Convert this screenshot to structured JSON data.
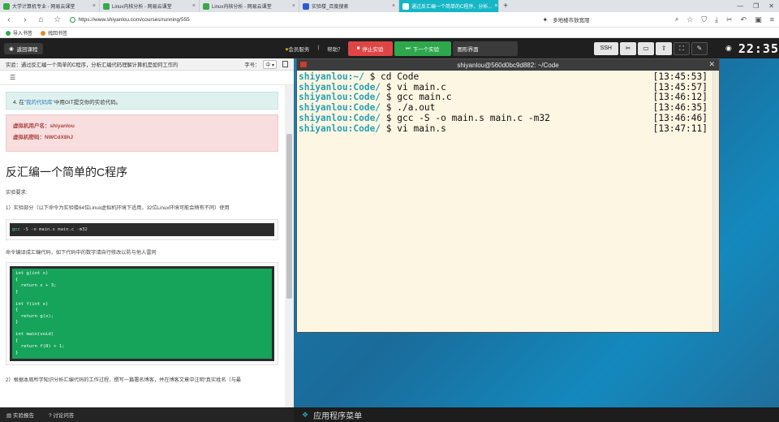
{
  "browser": {
    "tabs": [
      {
        "label": "大学计算机专业 - 网易云课堂",
        "active": false
      },
      {
        "label": "Linux内核分析 - 网易云课堂",
        "active": false
      },
      {
        "label": "Linux内核分析 - 网易云课堂",
        "active": false
      },
      {
        "label": "实验楼_百度搜索",
        "active": false
      },
      {
        "label": "通过反汇编一个简单的C程序，分析...",
        "active": true
      }
    ],
    "new_tab": "+",
    "url": "https://www.shiyanlou.com/courses/running/555",
    "search_text": "多地楼市放宽限",
    "bookmarks": [
      "导入书签",
      "找回书签"
    ]
  },
  "lab_topbar": {
    "back_label": "返回课程",
    "vip_label": "会员服务",
    "help_label": "帮助？",
    "stop_label": "停止实验",
    "next_label": "下一个实验",
    "gui_label": "图形界面",
    "ssh_label": "SSH",
    "clock": "22:35"
  },
  "left_panel": {
    "header": "实验：通过反汇编一个简单的C程序，分析汇编代码理解计算机是如何工作的",
    "font_label": "字号：",
    "font_size": "中",
    "info_step": "4. 在",
    "info_link": "\"我的代码库\"",
    "info_rest": "中用GIT提交你的实验代码。",
    "vm_user": "虚拟机用户名：shiyanlou",
    "vm_pass": "虚拟机密码：NWCdX8hJ",
    "section_title": "反汇编一个简单的C程序",
    "req_label": "实验要求:",
    "req_1": "1）实验部分（以下命令为实验楼64位Linux虚拟机环境下适用，32位Linux环境可能会稍有不同）使用",
    "cmd_gcc": "gcc",
    "cmd_rest": " -S -o main.s main.c -m32",
    "req_1b": "命令编译成汇编代码，如下代码中的数字请自行修改以防与他人雷同",
    "code": "int g(int x)\n{\n  return x + 3;\n}\n\nint f(int x)\n{\n  return g(x);\n}\n\nint main(void)\n{\n  return f(8) + 1;\n}",
    "req_2": "2）根据本周所学知识分析汇编代码的工作过程，撰写一篇署名博客，并在博客文章中注明“真实姓名（与最",
    "footer_report": "实验报告",
    "footer_qa": "讨论问答"
  },
  "terminal": {
    "title": "shiyanlou@560d0bc9d882: ~/Code",
    "lines": [
      {
        "user": "shiyanlou",
        "path": ":~/",
        "cmd": " $ cd Code",
        "time": "[13:45:53]"
      },
      {
        "user": "shiyanlou",
        "path": ":Code/",
        "cmd": " $ vi main.c",
        "time": "[13:45:57]"
      },
      {
        "user": "shiyanlou",
        "path": ":Code/",
        "cmd": " $ gcc main.c",
        "time": "[13:46:12]"
      },
      {
        "user": "shiyanlou",
        "path": ":Code/",
        "cmd": " $ ./a.out",
        "time": "[13:46:35]"
      },
      {
        "user": "shiyanlou",
        "path": ":Code/",
        "cmd": " $ gcc -S -o main.s main.c -m32",
        "time": "[13:46:46]"
      },
      {
        "user": "shiyanlou",
        "path": ":Code/",
        "cmd": " $ vi main.s",
        "time": "[13:47:11]"
      }
    ]
  },
  "taskbar": {
    "menu_label": "应用程序菜单"
  }
}
